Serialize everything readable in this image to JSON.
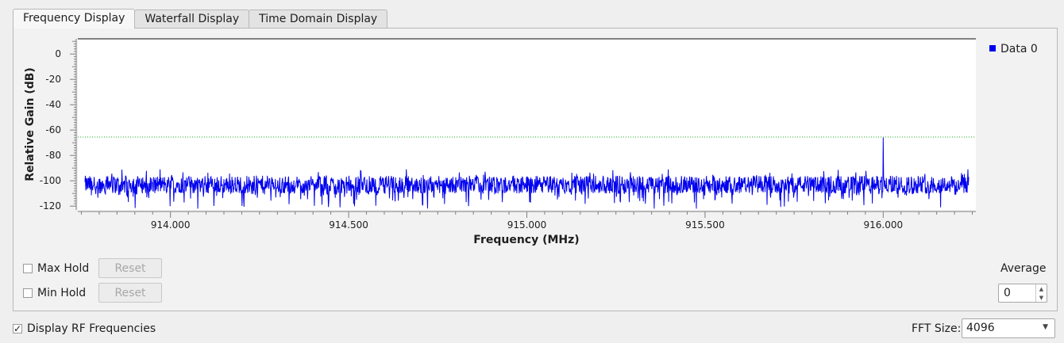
{
  "tabs": [
    {
      "label": "Frequency Display",
      "active": true
    },
    {
      "label": "Waterfall Display",
      "active": false
    },
    {
      "label": "Time Domain Display",
      "active": false
    }
  ],
  "chart_data": {
    "type": "line",
    "xlabel": "Frequency (MHz)",
    "ylabel": "Relative Gain (dB)",
    "xlim": [
      913.74,
      916.26
    ],
    "ylim": [
      -123,
      12
    ],
    "x_ticks": [
      "914.000",
      "914.500",
      "915.000",
      "915.500",
      "916.000"
    ],
    "x_tick_values": [
      914.0,
      914.5,
      915.0,
      915.5,
      916.0
    ],
    "y_ticks": [
      0,
      -20,
      -40,
      -60,
      -80,
      -100,
      -120
    ],
    "series": [
      {
        "name": "Data 0",
        "color": "#0000ff",
        "noise_floor_db": -103,
        "noise_range_db": [
          -122,
          -91
        ],
        "peak": {
          "x": 916.0,
          "y": -66
        }
      }
    ],
    "threshold_line": {
      "y": -65.5,
      "color": "#00aa00",
      "style": "dotted"
    },
    "legend_position": "top-right",
    "grid": false
  },
  "legend": {
    "label": "Data 0",
    "color": "#0000ff"
  },
  "controls": {
    "max_hold_label": "Max Hold",
    "min_hold_label": "Min Hold",
    "reset_label": "Reset",
    "average_label": "Average",
    "average_value": "0",
    "display_rf_label": "Display RF Frequencies",
    "display_rf_checked": true,
    "fft_label": "FFT Size:",
    "fft_value": "4096"
  }
}
